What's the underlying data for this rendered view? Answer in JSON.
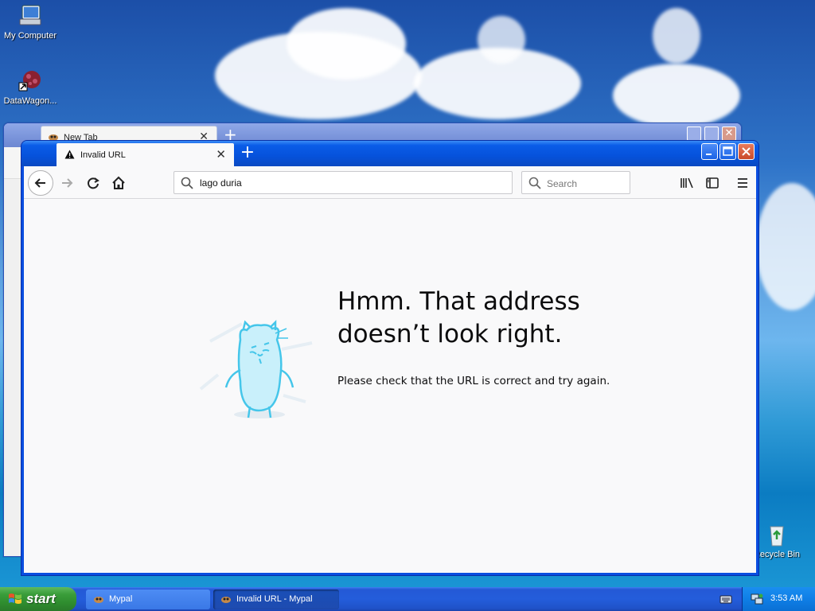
{
  "desktop": {
    "icons": [
      {
        "label": "My Computer",
        "icon": "my-computer-icon"
      },
      {
        "label": "DataWagon...",
        "icon": "datawagon-icon"
      },
      {
        "label": "Recycle Bin",
        "icon": "recycle-bin-icon"
      }
    ]
  },
  "background_window": {
    "tab_label": "New Tab"
  },
  "browser": {
    "tab_label": "Invalid URL",
    "url_value": "lago duria",
    "search_placeholder": "Search",
    "error_title": "Hmm. That address doesn’t look right.",
    "error_description": "Please check that the URL is correct and try again."
  },
  "taskbar": {
    "start_label": "start",
    "tasks": [
      {
        "label": "Mypal",
        "active": false
      },
      {
        "label": "Invalid URL - Mypal",
        "active": true
      }
    ],
    "clock": "3:53 AM"
  },
  "colors": {
    "accent_blue": "#0a5ce8",
    "close_red": "#c94a2a",
    "start_green": "#3a9d3a"
  }
}
